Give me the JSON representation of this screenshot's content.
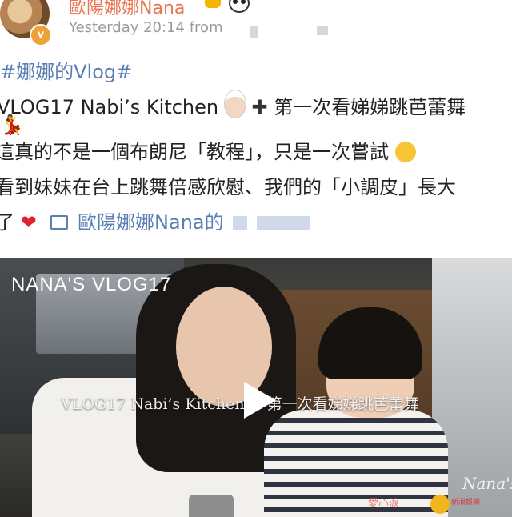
{
  "post": {
    "username": "歐陽娜娜Nana",
    "verified_badge": "v",
    "timestamp": "Yesterday 20:14",
    "from_label": "from",
    "hashtag": "#娜娜的Vlog#",
    "line1": "VLOG17 Nabi’s Kitchen",
    "line1_after": "第一次看娣娣跳芭蕾舞",
    "line2": "這真的不是一個布朗尼「教程」，只是一次嘗試",
    "line3": "看到妹妹在台上跳舞倍感欣慰、我們的「小調皮」長大",
    "line4_prefix": "了",
    "heart": "❤",
    "link_text": "歐陽娜娜Nana的",
    "icons": [
      "crown-icon",
      "panda-icon",
      "chef-icon",
      "plus-icon",
      "dancer-icon",
      "laugh-icon",
      "heart-icon",
      "link-icon",
      "play-icon"
    ]
  },
  "video": {
    "title": "NANA'S VLOG17",
    "subtitle": "VLOG17  Nabi’s Kitchen   +  第一次看娣娣跳芭蕾舞",
    "signature": "Nana's",
    "watermark_left": "愛心淚",
    "watermark_right": "新浪娛樂"
  },
  "colors": {
    "username": "#eb7350",
    "link": "#5b7fb3",
    "meta": "#9a9a9a",
    "text": "#222222"
  }
}
